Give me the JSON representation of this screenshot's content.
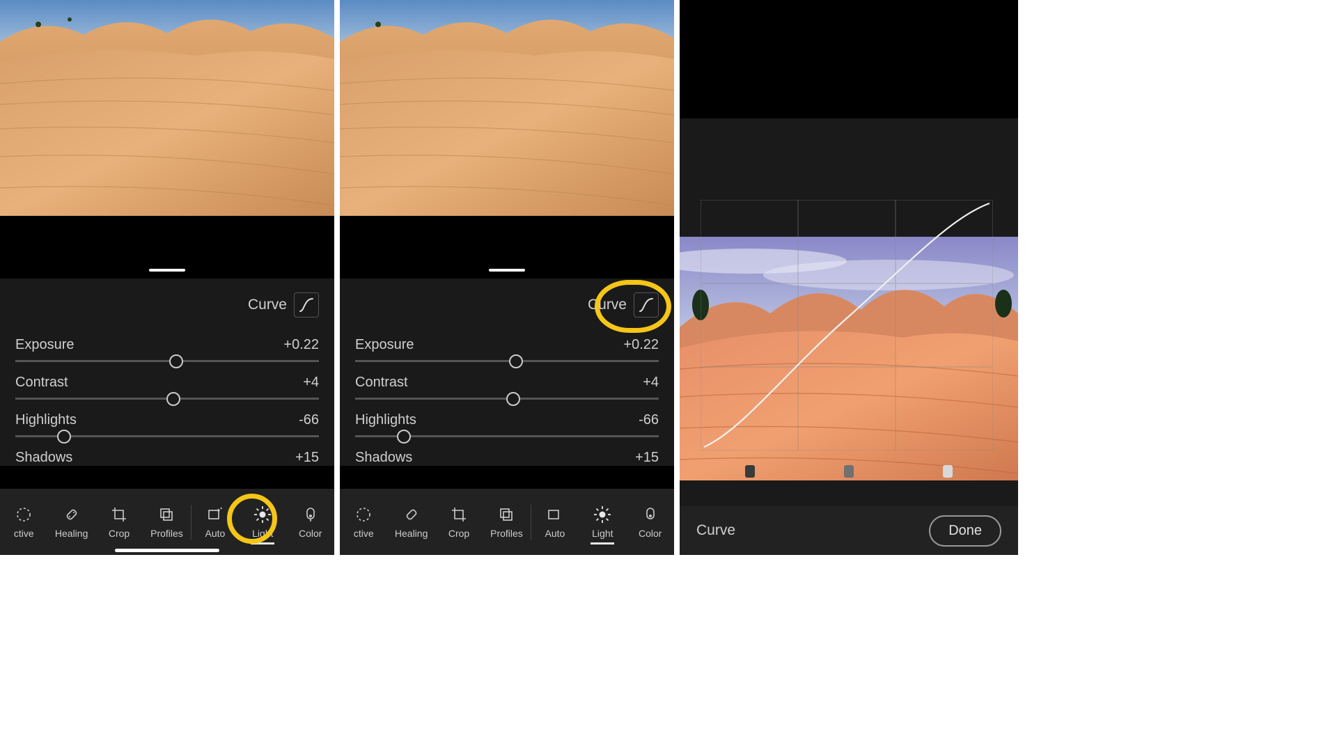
{
  "sliders": {
    "exposure": {
      "label": "Exposure",
      "value": "+0.22",
      "pos": 53
    },
    "contrast": {
      "label": "Contrast",
      "value": "+4",
      "pos": 52
    },
    "highlights": {
      "label": "Highlights",
      "value": "-66",
      "pos": 16
    },
    "shadows": {
      "label": "Shadows",
      "value": "+15"
    }
  },
  "curve": {
    "label": "Curve"
  },
  "toolbar": {
    "items": [
      {
        "key": "selective",
        "label": "ctive"
      },
      {
        "key": "healing",
        "label": "Healing"
      },
      {
        "key": "crop",
        "label": "Crop"
      },
      {
        "key": "profiles",
        "label": "Profiles"
      },
      {
        "key": "auto",
        "label": "Auto"
      },
      {
        "key": "light",
        "label": "Light",
        "selected": true
      },
      {
        "key": "color",
        "label": "Color"
      }
    ]
  },
  "curve_view": {
    "title": "Curve",
    "done": "Done"
  }
}
